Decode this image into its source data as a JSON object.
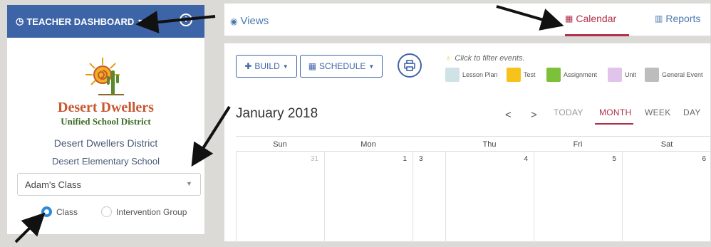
{
  "sidebar": {
    "title": "TEACHER DASHBOARD",
    "info_icon": "info-icon",
    "district_name": "Desert Dwellers",
    "district_sub": "Unified School District",
    "district_line": "Desert Dwellers District",
    "school_line": "Desert Elementary School",
    "class_select_value": "Adam's Class",
    "radio_class_label": "Class",
    "radio_intervention_label": "Intervention Group"
  },
  "topbar": {
    "views_label": "Views",
    "calendar_label": "Calendar",
    "reports_label": "Reports"
  },
  "toolbar": {
    "build_label": "BUILD",
    "schedule_label": "SCHEDULE",
    "filter_hint": "Click to filter events.",
    "legend": [
      {
        "label": "Lesson Plan",
        "color": "#cfe3e6"
      },
      {
        "label": "Test",
        "color": "#f7c21a"
      },
      {
        "label": "Assignment",
        "color": "#7dc13a"
      },
      {
        "label": "Unit",
        "color": "#e1c4ea"
      },
      {
        "label": "General Event",
        "color": "#bdbdbd"
      }
    ]
  },
  "calendar": {
    "month_title": "January 2018",
    "prev_label": "<",
    "next_label": ">",
    "today_label": "TODAY",
    "month_label": "MONTH",
    "week_label": "WEEK",
    "day_label": "DAY",
    "day_headers": [
      "Sun",
      "Mon",
      "Thu",
      "Fri",
      "Sat"
    ],
    "dates": [
      "31",
      "1",
      "3",
      "4",
      "5",
      "6"
    ]
  },
  "colors": {
    "header_blue": "#3e64a8",
    "accent_red": "#b0304a",
    "link_blue": "#4a78b0"
  }
}
